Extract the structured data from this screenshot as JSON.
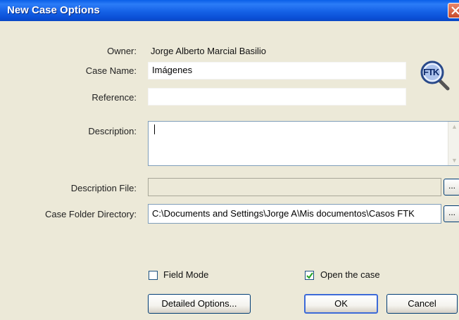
{
  "window": {
    "title": "New Case Options",
    "close_icon": "close-icon",
    "logo_text": "FTK"
  },
  "form": {
    "owner_label": "Owner:",
    "owner_value": "Jorge Alberto Marcial Basilio",
    "case_name_label": "Case Name:",
    "case_name_value": "Imágenes",
    "reference_label": "Reference:",
    "reference_value": "",
    "description_label": "Description:",
    "description_value": "",
    "description_file_label": "Description File:",
    "description_file_value": "",
    "description_file_browse": "...",
    "case_folder_label": "Case Folder Directory:",
    "case_folder_value": "C:\\Documents and Settings\\Jorge A\\Mis documentos\\Casos FTK",
    "case_folder_browse": "..."
  },
  "options": {
    "field_mode_label": "Field Mode",
    "field_mode_checked": false,
    "open_case_label": "Open the case",
    "open_case_checked": true
  },
  "buttons": {
    "detailed_options": "Detailed Options...",
    "ok": "OK",
    "cancel": "Cancel"
  },
  "colors": {
    "titlebar": "#0a5fe8",
    "close_button": "#d8613f",
    "dialog_background": "#ece9d8",
    "button_border": "#003c74"
  }
}
